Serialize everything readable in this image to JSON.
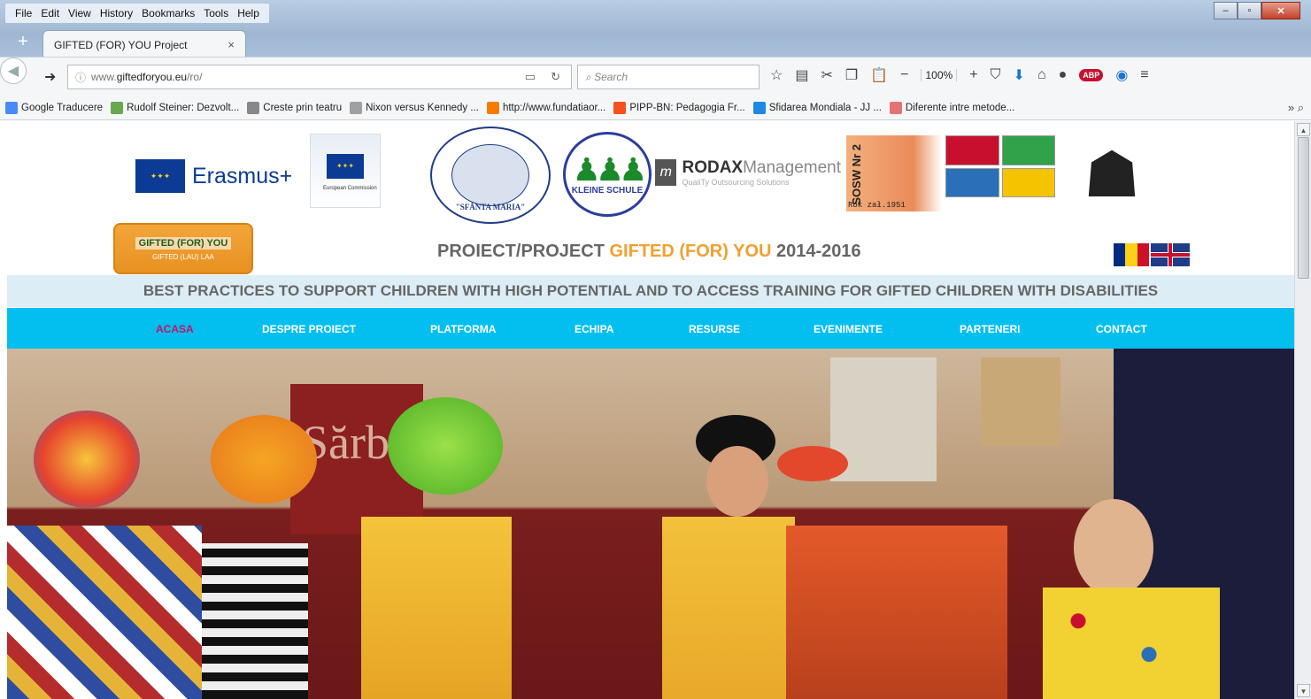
{
  "menu": [
    "File",
    "Edit",
    "View",
    "History",
    "Bookmarks",
    "Tools",
    "Help"
  ],
  "tab": {
    "title": "GIFTED (FOR) YOU Project",
    "close": "×",
    "new": "+"
  },
  "url": {
    "pre": "www.",
    "host": "giftedforyou.eu",
    "path": "/ro/"
  },
  "search": {
    "placeholder": "Search"
  },
  "toolbar": {
    "zoom": "100%"
  },
  "bookmarks": [
    {
      "label": "Google Traducere",
      "color": "#4a8af4"
    },
    {
      "label": "Rudolf Steiner: Dezvolt...",
      "color": "#6aa84f"
    },
    {
      "label": "Creste prin teatru",
      "color": "#888888"
    },
    {
      "label": "Nixon versus Kennedy ...",
      "color": "#a0a0a0"
    },
    {
      "label": "http://www.fundatiaor...",
      "color": "#f57c00"
    },
    {
      "label": "PIPP-BN: Pedagogia Fr...",
      "color": "#f4511e"
    },
    {
      "label": "Sfidarea Mondiala - JJ ...",
      "color": "#1e88e5"
    },
    {
      "label": "Diferente intre metode...",
      "color": "#e57373"
    }
  ],
  "logos": {
    "erasmus": "Erasmus+",
    "ec": "European Commission",
    "sfanta": "\"SFÂNTA MARIA\"",
    "kleine": "KLEINE SCHULE",
    "rodax_bold": "RODAX",
    "rodax_light": "Management",
    "rodax_sub": "QualiTy Outsourcing Solutions",
    "sosw": "SOSW Nr 2",
    "sosw_year": "Rok zał.1951",
    "gifted1": "GIFTED (FOR) YOU",
    "gifted2": "GIFTED (LAU) LAA"
  },
  "header": {
    "title_pre": "PROIECT/PROJECT ",
    "title_hl": "GIFTED (FOR) YOU",
    "title_post": " 2014-2016"
  },
  "tagline": "BEST PRACTICES TO SUPPORT CHILDREN WITH HIGH POTENTIAL AND TO ACCESS TRAINING FOR GIFTED CHILDREN WITH DISABILITIES",
  "nav": [
    "ACASA",
    "DESPRE PROIECT",
    "PLATFORMA",
    "ECHIPA",
    "RESURSE",
    "EVENIMENTE",
    "PARTENERI",
    "CONTACT"
  ],
  "hero_text": "Sărbă",
  "colors": {
    "nav_bg": "#03bff0",
    "nav_active": "#c41467",
    "highlight": "#f0a030",
    "tagline_bg": "#dcedf5"
  }
}
